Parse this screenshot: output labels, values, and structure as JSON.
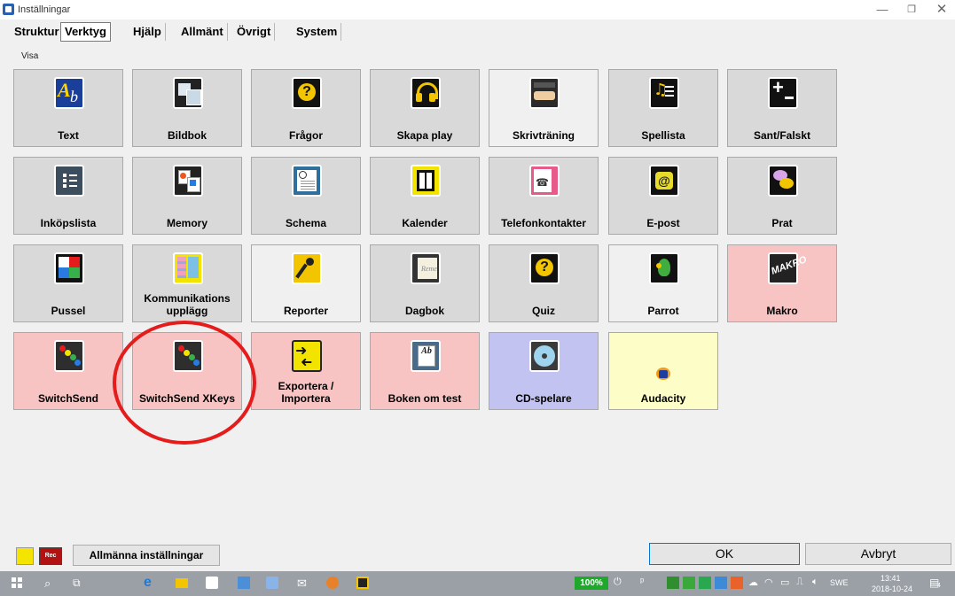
{
  "window": {
    "title": "Inställningar"
  },
  "tabs": [
    "Struktur",
    "Verktyg",
    "Hjälp",
    "Allmänt",
    "Övrigt",
    "System"
  ],
  "section_label": "Visa",
  "tools": [
    {
      "label": "Text",
      "icon": "text-icon"
    },
    {
      "label": "Bildbok",
      "icon": "picture-book-icon"
    },
    {
      "label": "Frågor",
      "icon": "question-icon"
    },
    {
      "label": "Skapa play",
      "icon": "headphones-icon"
    },
    {
      "label": "Skrivträning",
      "icon": "typing-icon"
    },
    {
      "label": "Spellista",
      "icon": "playlist-icon"
    },
    {
      "label": "Sant/Falskt",
      "icon": "plus-minus-icon"
    },
    {
      "label": "Inköpslista",
      "icon": "shopping-list-icon"
    },
    {
      "label": "Memory",
      "icon": "memory-cards-icon"
    },
    {
      "label": "Schema",
      "icon": "schedule-icon"
    },
    {
      "label": "Kalender",
      "icon": "calendar-icon"
    },
    {
      "label": "Telefonkontakter",
      "icon": "phone-icon"
    },
    {
      "label": "E-post",
      "icon": "email-icon"
    },
    {
      "label": "Prat",
      "icon": "chat-icon"
    },
    {
      "label": "Pussel",
      "icon": "puzzle-icon"
    },
    {
      "label": "Kommunikations upplägg",
      "icon": "communication-board-icon"
    },
    {
      "label": "Reporter",
      "icon": "microphone-icon"
    },
    {
      "label": "Dagbok",
      "icon": "diary-icon"
    },
    {
      "label": "Quiz",
      "icon": "quiz-icon"
    },
    {
      "label": "Parrot",
      "icon": "parrot-icon"
    },
    {
      "label": "Makro",
      "icon": "macro-icon"
    },
    {
      "label": "SwitchSend",
      "icon": "switch-send-icon"
    },
    {
      "label": "SwitchSend XKeys",
      "icon": "switch-send-xkeys-icon"
    },
    {
      "label": "Exportera / Importera",
      "icon": "export-import-icon"
    },
    {
      "label": "Boken om test",
      "icon": "book-icon"
    },
    {
      "label": "CD-spelare",
      "icon": "cd-icon"
    },
    {
      "label": "Audacity",
      "icon": "audacity-icon"
    }
  ],
  "footer": {
    "general_settings": "Allmänna inställningar",
    "rec": "Rec",
    "ok": "OK",
    "cancel": "Avbryt"
  },
  "taskbar": {
    "battery": "100%",
    "language": "SWE",
    "time": "13:41",
    "date": "2018-10-24",
    "notifications": "4"
  },
  "colors": {
    "tile_gray": "#d9d9d9",
    "tile_pink": "#f8c3c3",
    "tile_blue": "#c3c3f2",
    "tile_yellow": "#fdfdc8",
    "ring": "#e51c1c"
  }
}
